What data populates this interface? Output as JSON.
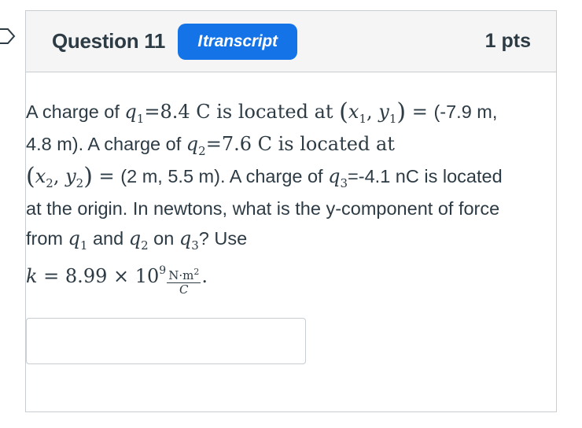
{
  "question": {
    "title": "Question 11",
    "badge_label": "transcript",
    "badge_icon": "I",
    "points": "1 pts",
    "text": {
      "p1": "A charge of ",
      "q1": "q",
      "q1_sub": "1",
      "v1": "=8.4 C is located at ",
      "x1": "x",
      "x1_sub": "1",
      "comma1": ", ",
      "y1": "y",
      "y1_sub": "1",
      "eq1": " = ",
      "coords1": "(-7.9 m, 4.8 m). A charge of ",
      "q2": "q",
      "q2_sub": "2",
      "v2": "=7.6 C is located at ",
      "x2": "x",
      "x2_sub": "2",
      "comma2": ", ",
      "y2": "y",
      "y2_sub": "2",
      "eq2": " = ",
      "coords2": "(2 m, 5.5 m). A charge of ",
      "q3": "q",
      "q3_sub": "3",
      "v3": "=-4.1 nC is located at the origin. In newtons, what is the y-component of force from ",
      "q1b": "q",
      "q1b_sub": "1",
      "and": " and ",
      "q2b": "q",
      "q2b_sub": "2",
      "on": " on ",
      "q3b": "q",
      "q3b_sub": "3",
      "use": "? Use",
      "k_lhs": "k",
      "k_eq": " = 8.99 × 10",
      "k_exp": "9",
      "frac_num": "N·m",
      "frac_num_exp": "2",
      "frac_den": "C",
      "period": "."
    },
    "answer_value": ""
  },
  "colors": {
    "badge_bg": "#1473e6",
    "header_bg": "#f5f5f5",
    "text": "#2d3b45",
    "border": "#c7cdd1"
  }
}
